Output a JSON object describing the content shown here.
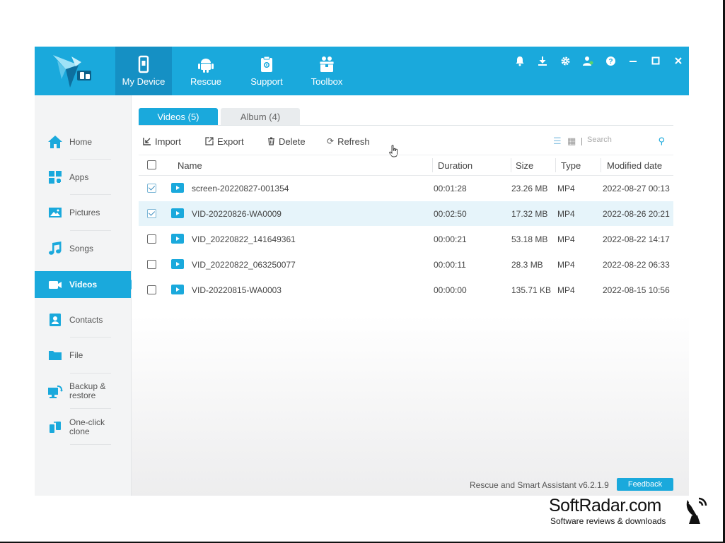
{
  "topbar": {
    "nav": [
      {
        "label": "My Device",
        "icon": "phone-icon",
        "active": true
      },
      {
        "label": "Rescue",
        "icon": "android-icon",
        "active": false
      },
      {
        "label": "Support",
        "icon": "support-icon",
        "active": false
      },
      {
        "label": "Toolbox",
        "icon": "toolbox-icon",
        "active": false
      }
    ],
    "window_icons": [
      "bell-icon",
      "download-icon",
      "gear-icon",
      "user-icon",
      "help-icon",
      "minimize-icon",
      "maximize-icon",
      "close-icon"
    ]
  },
  "sidebar": {
    "items": [
      {
        "label": "Home",
        "icon": "home-icon"
      },
      {
        "label": "Apps",
        "icon": "apps-icon"
      },
      {
        "label": "Pictures",
        "icon": "pictures-icon"
      },
      {
        "label": "Songs",
        "icon": "music-icon"
      },
      {
        "label": "Videos",
        "icon": "video-camera-icon",
        "active": true
      },
      {
        "label": "Contacts",
        "icon": "contacts-icon"
      },
      {
        "label": "File",
        "icon": "folder-icon"
      },
      {
        "label": "Backup &",
        "label2": "restore",
        "icon": "backup-icon"
      },
      {
        "label": "One-click",
        "label2": "clone",
        "icon": "clone-icon"
      }
    ]
  },
  "tabs": [
    {
      "label": "Videos (5)",
      "active": true
    },
    {
      "label": "Album (4)",
      "active": false
    }
  ],
  "toolbar": {
    "import": "Import",
    "export": "Export",
    "delete": "Delete",
    "refresh": "Refresh",
    "search_placeholder": "Search"
  },
  "table": {
    "headers": {
      "name": "Name",
      "duration": "Duration",
      "size": "Size",
      "type": "Type",
      "modified": "Modified date"
    },
    "rows": [
      {
        "checked": true,
        "selected": false,
        "name": "screen-20220827-001354",
        "duration": "00:01:28",
        "size": "23.26 MB",
        "type": "MP4",
        "modified": "2022-08-27 00:13"
      },
      {
        "checked": true,
        "selected": true,
        "name": "VID-20220826-WA0009",
        "duration": "00:02:50",
        "size": "17.32 MB",
        "type": "MP4",
        "modified": "2022-08-26 20:21"
      },
      {
        "checked": false,
        "selected": false,
        "name": "VID_20220822_141649361",
        "duration": "00:00:21",
        "size": "53.18 MB",
        "type": "MP4",
        "modified": "2022-08-22 14:17"
      },
      {
        "checked": false,
        "selected": false,
        "name": "VID_20220822_063250077",
        "duration": "00:00:11",
        "size": "28.3 MB",
        "type": "MP4",
        "modified": "2022-08-22 06:33"
      },
      {
        "checked": false,
        "selected": false,
        "name": "VID-20220815-WA0003",
        "duration": "00:00:00",
        "size": "135.71 KB",
        "type": "MP4",
        "modified": "2022-08-15 10:56"
      }
    ]
  },
  "footer": {
    "version": "Rescue and Smart Assistant v6.2.1.9",
    "feedback": "Feedback"
  },
  "watermark": {
    "title": "SoftRadar.com",
    "subtitle": "Software reviews & downloads"
  },
  "colors": {
    "accent": "#1aa9dc",
    "accent_dark": "#1590c4",
    "selected_row": "#e6f4fa"
  }
}
